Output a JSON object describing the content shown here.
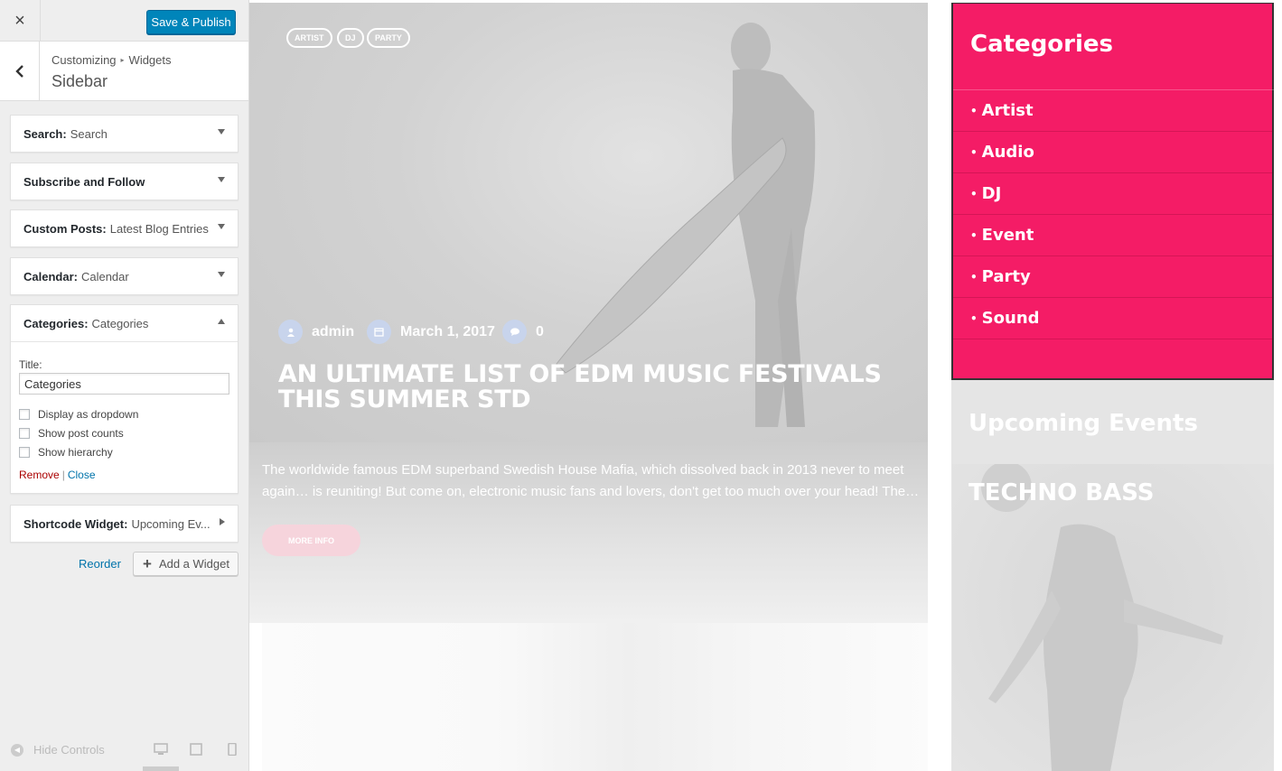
{
  "topbar": {
    "close_label": "×",
    "publish_label": "Save & Publish"
  },
  "section": {
    "breadcrumb_root": "Customizing",
    "breadcrumb_sep": "▸",
    "breadcrumb_child": "Widgets",
    "title": "Sidebar"
  },
  "widgets": [
    {
      "type": "Search:",
      "title": "Search",
      "state": "collapsed"
    },
    {
      "type": "Subscribe and Follow",
      "title": "",
      "state": "collapsed"
    },
    {
      "type": "Custom Posts:",
      "title": "Latest Blog Entries",
      "state": "collapsed"
    },
    {
      "type": "Calendar:",
      "title": "Calendar",
      "state": "collapsed"
    },
    {
      "type": "Categories:",
      "title": "Categories",
      "state": "expanded"
    },
    {
      "type": "Shortcode Widget:",
      "title": "Upcoming Ev...",
      "state": "collapsed"
    }
  ],
  "categories_form": {
    "title_label": "Title:",
    "title_value": "Categories",
    "options": [
      {
        "label": "Display as dropdown",
        "checked": false
      },
      {
        "label": "Show post counts",
        "checked": false
      },
      {
        "label": "Show hierarchy",
        "checked": false
      }
    ],
    "remove_label": "Remove",
    "pipe": "|",
    "close_label": "Close"
  },
  "panel_actions": {
    "reorder_label": "Reorder",
    "add_widget_label": "Add a Widget"
  },
  "footer": {
    "hide_controls_label": "Hide Controls",
    "devices": [
      "desktop-icon",
      "tablet-icon",
      "mobile-icon"
    ]
  },
  "post": {
    "tags": [
      "ARTIST",
      "DJ",
      "PARTY"
    ],
    "author": "admin",
    "date": "March 1, 2017",
    "comments": "0",
    "title": "AN ULTIMATE LIST OF EDM MUSIC FESTIVALS THIS SUMMER STD",
    "excerpt": "The worldwide famous EDM superband Swedish House Mafia, which dissolved back in 2013 never to meet again… is reuniting! But come on, electronic music fans and lovers, don't get too much over your head! The…",
    "more_label": "MORE INFO"
  },
  "sidebar_preview": {
    "categories_title": "Categories",
    "categories": [
      "Artist",
      "Audio",
      "DJ",
      "Event",
      "Party",
      "Sound"
    ],
    "bullet": "•",
    "events_title": "Upcoming Events",
    "event_name": "TECHNO BASS"
  },
  "colors": {
    "accent_pink": "#f41c66",
    "wp_blue": "#0085ba",
    "link_blue": "#0073aa",
    "remove_red": "#aa0000"
  }
}
